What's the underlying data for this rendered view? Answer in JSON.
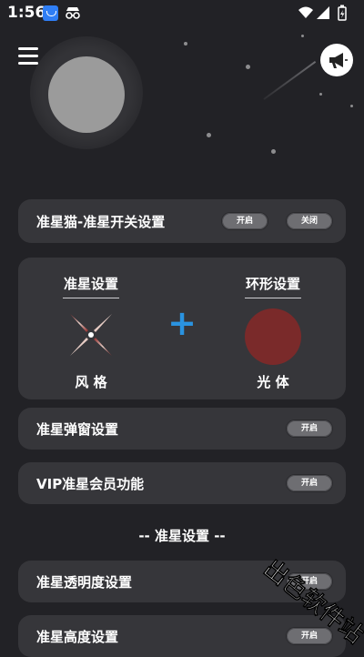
{
  "status_bar": {
    "time": "1:56"
  },
  "header": {
    "menu_icon": "hamburger-menu-icon",
    "announce_icon": "megaphone-icon"
  },
  "toggle_row": {
    "label": "准星猫-准星开关设置",
    "on_label": "开启",
    "off_label": "关闭"
  },
  "crosshair_panel": {
    "left_title": "准星设置",
    "right_title": "环形设置",
    "plus_symbol": "+",
    "left_sub": "风 格",
    "right_sub": "光 体",
    "accent_color": "#2a93e0",
    "glow_color": "#7a2a2a"
  },
  "popup_row": {
    "label": "准星弹窗设置",
    "button": "开启"
  },
  "vip_row": {
    "label": "VIP准星会员功能",
    "button": "开启"
  },
  "section_divider": "-- 准星设置 --",
  "opacity_row": {
    "label": "准星透明度设置",
    "button": "开启"
  },
  "height_row": {
    "label": "准星高度设置",
    "button": "开启"
  },
  "watermark": {
    "text": "出色软件站"
  }
}
